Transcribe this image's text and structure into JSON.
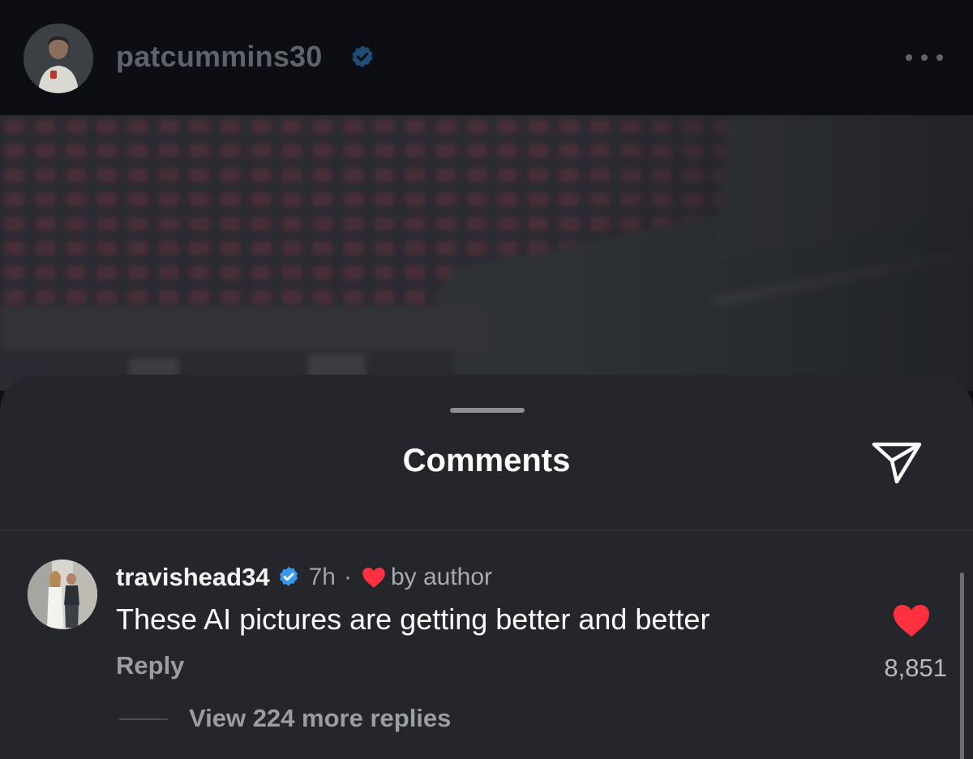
{
  "post": {
    "username": "patcummins30",
    "verified": true,
    "more_icon": "more-horizontal-icon"
  },
  "comments_sheet": {
    "title": "Comments",
    "share_icon": "send-icon"
  },
  "comment": {
    "username": "travishead34",
    "verified": true,
    "time": "7h",
    "separator": "·",
    "liked_by_author_label": "by author",
    "text": "These AI pictures are getting better and better",
    "reply_label": "Reply",
    "like_count": "8,851",
    "liked": true,
    "view_replies_label": "View 224 more replies"
  },
  "colors": {
    "like_red": "#ff3040",
    "verified_blue": "#0095f6",
    "sheet_bg": "#24262c"
  }
}
